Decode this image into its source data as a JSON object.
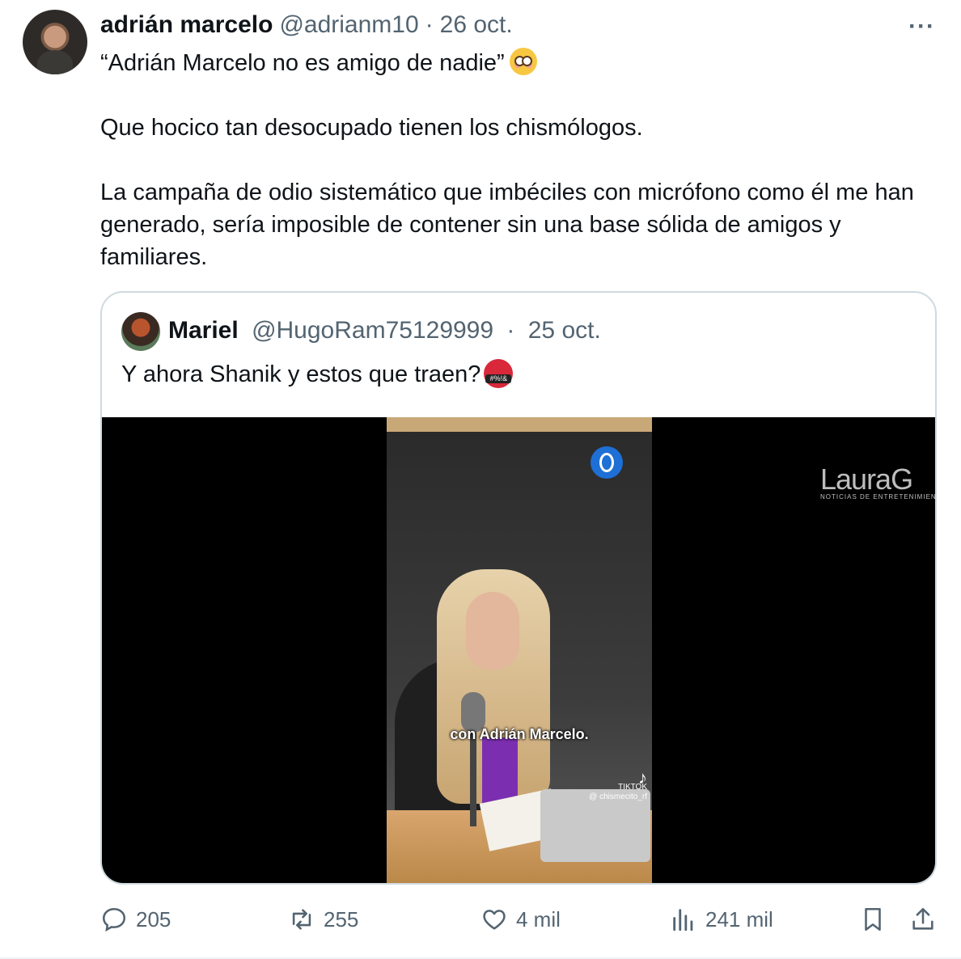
{
  "tweet": {
    "author_name": "adrián marcelo",
    "author_handle": "@adrianm10",
    "separator": "·",
    "date": "26 oct.",
    "more_label": "···",
    "paragraph_1": "“Adrián Marcelo no es amigo de nadie”",
    "paragraph_2": "Que hocico tan desocupado tienen los chismólogos.",
    "paragraph_3": "La campaña de odio sistemático que imbéciles con micrófono como él me han generado, sería imposible de contener sin una base sólida de amigos y familiares.",
    "emoji": "flushed-face"
  },
  "quote": {
    "author_name": "Mariel",
    "author_handle": "@HugoRam75129999",
    "separator": "·",
    "date": "25 oct.",
    "text": "Y ahora Shanik y estos que traen?",
    "emoji": "face-with-symbols-on-mouth",
    "emoji_symbols": "#%!&",
    "video": {
      "caption": "con Adrián Marcelo.",
      "tiktok_label": "TIKTOK",
      "tiktok_user": "@ chismecito_rf",
      "watermark": "LauraG",
      "watermark_sub": "NOTICIAS DE ENTRETENIMIEN"
    }
  },
  "actions": {
    "replies": "205",
    "retweets": "255",
    "likes": "4 mil",
    "views": "241 mil"
  },
  "colors": {
    "text": "#0f1419",
    "secondary": "#536471",
    "border": "#cfd9de"
  }
}
